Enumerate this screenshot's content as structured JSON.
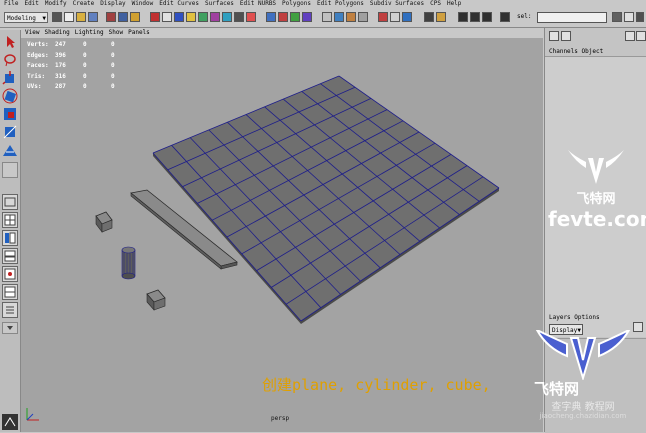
{
  "menubar": {
    "items": [
      "File",
      "Edit",
      "Modify",
      "Create",
      "Display",
      "Window",
      "Edit Curves",
      "Surfaces",
      "Edit NURBS",
      "Polygons",
      "Edit Polygons",
      "Subdiv Surfaces",
      "CPS",
      "Help"
    ]
  },
  "statusline": {
    "mode": "Modeling",
    "sel_label": "sel:"
  },
  "viewport": {
    "panel_menu": [
      "View",
      "Shading",
      "Lighting",
      "Show",
      "Panels"
    ],
    "hud": [
      {
        "label": "Verts:",
        "a": "247",
        "b": "0",
        "c": "0"
      },
      {
        "label": "Edges:",
        "a": "396",
        "b": "0",
        "c": "0"
      },
      {
        "label": "Faces:",
        "a": "176",
        "b": "0",
        "c": "0"
      },
      {
        "label": "Tris:",
        "a": "316",
        "b": "0",
        "c": "0"
      },
      {
        "label": "UVs:",
        "a": "287",
        "b": "0",
        "c": "0"
      }
    ],
    "caption": "创建plane, cylinder, cube,",
    "camera": "persp",
    "colors": {
      "background": "#a3a3a3",
      "mesh_fill": "#6f6f6f",
      "wireframe": "#1e1e8a",
      "caption": "#e0a000"
    }
  },
  "channel_box": {
    "title": "Channels Object"
  },
  "layer_editor": {
    "title": "Layers Options",
    "dropdown": "Display"
  },
  "watermark": {
    "top_cn": "飞特网",
    "top_url": "fevte.com",
    "bottom_cn": "飞特网",
    "bottom_sub": "查字典 教程网",
    "bottom_sub2": "jiaocheng.chazidian.com"
  }
}
